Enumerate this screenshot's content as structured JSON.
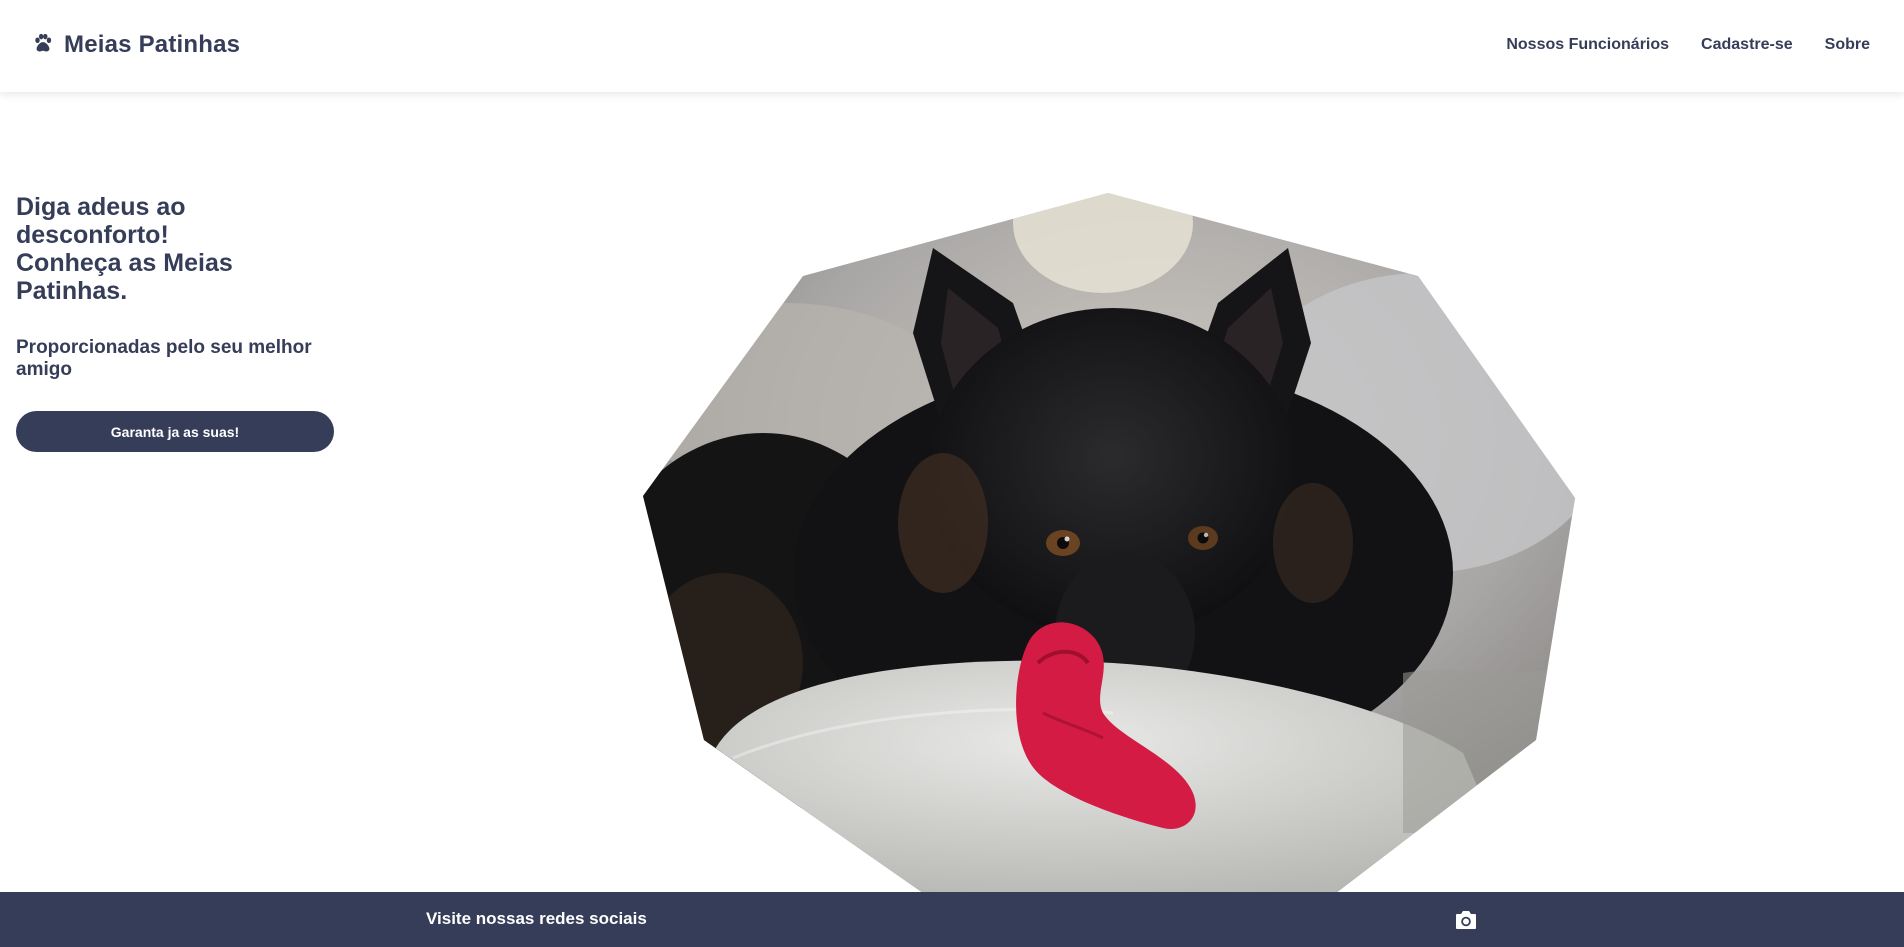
{
  "header": {
    "brand_icon": "paw-icon",
    "brand_title": "Meias Patinhas",
    "nav": [
      {
        "label": "Nossos Funcionários"
      },
      {
        "label": "Cadastre-se"
      },
      {
        "label": "Sobre"
      }
    ]
  },
  "hero": {
    "heading_lines": [
      "Diga adeus ao desconforto!",
      "Conheça as Meias",
      "Patinhas."
    ],
    "subheading_lines": [
      "Proporcionadas pelo seu melhor",
      "amigo"
    ],
    "cta_label": "Garanta ja as suas!",
    "image_subject": "black dog resting head on pillow with red sock"
  },
  "footer": {
    "social_text": "Visite nossas redes sociais",
    "social_icon": "camera-icon"
  },
  "colors": {
    "primary": "#363d59",
    "background": "#ffffff",
    "button_text": "#ffffff"
  }
}
